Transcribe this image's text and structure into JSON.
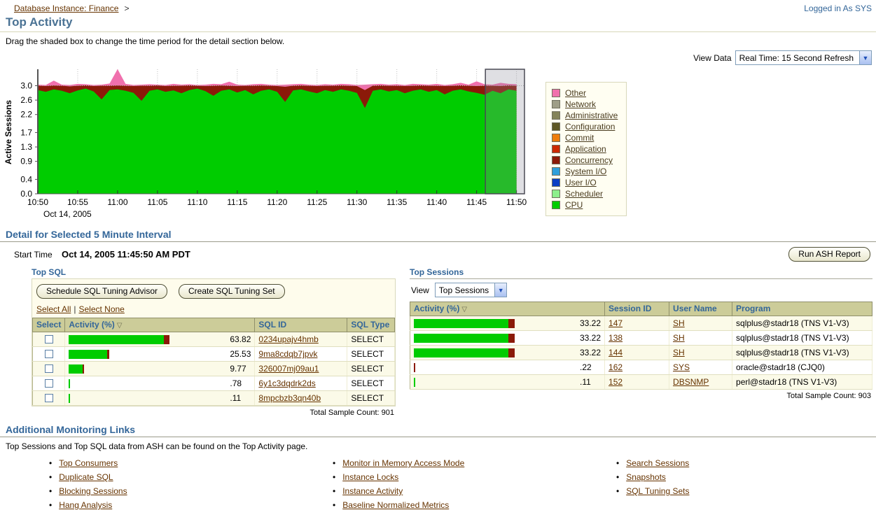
{
  "page": {
    "breadcrumb": "Database Instance: Finance",
    "breadcrumb_separator": ">",
    "logged_in": "Logged in As SYS",
    "title": "Top Activity",
    "instruction": "Drag the shaded box to change the time period for the detail section below.",
    "view_data_label": "View Data",
    "view_data_value": "Real Time: 15 Second Refresh",
    "dropdown_arrow": "▼"
  },
  "chart_data": {
    "type": "area",
    "title": "",
    "xlabel": "",
    "ylabel": "Active Sessions",
    "x_date_label": "Oct 14, 2005",
    "x_ticks": [
      "10:50",
      "10:55",
      "11:00",
      "11:05",
      "11:10",
      "11:15",
      "11:20",
      "11:25",
      "11:30",
      "11:35",
      "11:40",
      "11:45",
      "11:50"
    ],
    "y_ticks": [
      "0.0",
      "0.4",
      "0.9",
      "1.3",
      "1.7",
      "2.2",
      "2.6",
      "3.0"
    ],
    "y_tick_values": [
      0.0,
      0.4,
      0.9,
      1.3,
      1.7,
      2.2,
      2.6,
      3.0
    ],
    "ylim": [
      0,
      3.5
    ],
    "x_minutes_span": 61,
    "grid": "dotted vertical at 5-min marks, dotted horizontal at 3.0",
    "legend_position": "right",
    "selection_box": {
      "start_minute": 56.1,
      "end_minute": 61,
      "note": "shaded drag box over 11:46-11:51"
    },
    "legend": [
      {
        "label": "Other",
        "color": "#F070AD"
      },
      {
        "label": "Network",
        "color": "#9E9E87"
      },
      {
        "label": "Administrative",
        "color": "#84845A"
      },
      {
        "label": "Configuration",
        "color": "#5E5823"
      },
      {
        "label": "Commit",
        "color": "#EE7D0D"
      },
      {
        "label": "Application",
        "color": "#CC2A02"
      },
      {
        "label": "Concurrency",
        "color": "#8B1A09"
      },
      {
        "label": "System I/O",
        "color": "#2F9FDB"
      },
      {
        "label": "User I/O",
        "color": "#0B3EC4"
      },
      {
        "label": "Scheduler",
        "color": "#8CF08C"
      },
      {
        "label": "CPU",
        "color": "#00CC00"
      }
    ],
    "series": [
      {
        "name": "Other stack top",
        "color": "#F070AD",
        "values": [
          3.03,
          3.02,
          3.14,
          3.03,
          3.02,
          3.05,
          3.04,
          3.02,
          3.03,
          3.06,
          3.46,
          3.05,
          3.02,
          3.03,
          3.04,
          3.03,
          3.02,
          3.05,
          3.03,
          3.04,
          3.02,
          3.03,
          3.05,
          3.04,
          3.11,
          3.03,
          3.02,
          3.04,
          3.05,
          3.03,
          3.02,
          3.03,
          3.04,
          3.05,
          3.03,
          3.02,
          3.04,
          3.03,
          3.05,
          3.04,
          3.02,
          3.03,
          3.04,
          3.05,
          3.03,
          3.04,
          3.02,
          3.05,
          3.04,
          3.03,
          3.05,
          3.02,
          3.04,
          3.08,
          3.03,
          3.12,
          3.04,
          3.03,
          3.08,
          3.05,
          3.04
        ]
      },
      {
        "name": "Concurrency stack top",
        "color": "#8B1A09",
        "values": [
          3.0,
          2.99,
          3.01,
          3.0,
          2.98,
          3.0,
          3.01,
          2.99,
          3.0,
          3.0,
          3.01,
          3.0,
          2.99,
          3.0,
          3.0,
          3.01,
          2.99,
          3.0,
          3.0,
          3.01,
          3.0,
          2.99,
          3.0,
          3.01,
          3.0,
          2.99,
          3.0,
          3.0,
          3.01,
          3.0,
          2.99,
          2.97,
          3.0,
          3.01,
          3.0,
          2.99,
          3.0,
          3.0,
          3.01,
          3.0,
          2.99,
          2.88,
          3.0,
          3.01,
          3.0,
          3.0,
          2.99,
          3.0,
          3.01,
          3.0,
          3.0,
          2.99,
          3.0,
          3.01,
          3.0,
          2.99,
          3.0,
          3.0,
          2.99,
          3.01,
          3.0
        ]
      },
      {
        "name": "CPU",
        "color": "#00CC00",
        "values": [
          2.88,
          2.83,
          2.9,
          2.86,
          2.79,
          2.87,
          2.92,
          2.84,
          2.62,
          2.88,
          2.9,
          2.86,
          2.8,
          2.58,
          2.86,
          2.9,
          2.83,
          2.87,
          2.79,
          2.88,
          2.92,
          2.85,
          2.72,
          2.86,
          2.9,
          2.81,
          2.88,
          2.76,
          2.86,
          2.9,
          2.83,
          2.55,
          2.87,
          2.9,
          2.84,
          2.79,
          2.88,
          2.83,
          2.9,
          2.86,
          2.8,
          2.38,
          2.86,
          2.9,
          2.84,
          2.88,
          2.79,
          2.86,
          2.9,
          2.83,
          2.88,
          2.76,
          2.86,
          2.9,
          2.84,
          2.8,
          2.75,
          2.86,
          2.79,
          2.9,
          2.86
        ]
      }
    ]
  },
  "detail": {
    "title": "Detail for Selected 5 Minute Interval",
    "start_time_label": "Start Time",
    "start_time_value": "Oct 14, 2005 11:45:50 AM PDT",
    "run_ash_button": "Run ASH Report"
  },
  "top_sql": {
    "title": "Top SQL",
    "buttons": [
      "Schedule SQL Tuning Advisor",
      "Create SQL Tuning Set"
    ],
    "select_all": "Select All",
    "select_none": "Select None",
    "link_separator": "|",
    "columns": [
      "Select",
      "Activity (%)",
      "SQL ID",
      "SQL Type"
    ],
    "sort_indicator": "▽",
    "rows": [
      {
        "activity": "63.82",
        "bar_green": 60.5,
        "bar_red": 3.3,
        "sql_id": "0234upajv4hmb",
        "sql_type": "SELECT"
      },
      {
        "activity": "25.53",
        "bar_green": 24.2,
        "bar_red": 1.3,
        "sql_id": "9ma8cdqb7jpvk",
        "sql_type": "SELECT"
      },
      {
        "activity": "9.77",
        "bar_green": 8.7,
        "bar_red": 1.1,
        "sql_id": "326007mj09au1",
        "sql_type": "SELECT"
      },
      {
        "activity": ".78",
        "bar_green": 0.8,
        "bar_red": 0,
        "sql_id": "6y1c3dqdrk2ds",
        "sql_type": "SELECT"
      },
      {
        "activity": ".11",
        "bar_green": 0.4,
        "bar_red": 0,
        "sql_id": "8mpcbzb3qn40b",
        "sql_type": "SELECT"
      }
    ],
    "total": "Total Sample Count: 901"
  },
  "top_sessions": {
    "title": "Top Sessions",
    "view_label": "View",
    "view_value": "Top Sessions",
    "columns": [
      "Activity (%)",
      "Session ID",
      "User Name",
      "Program"
    ],
    "sort_indicator": "▽",
    "rows": [
      {
        "activity": "33.22",
        "bar_green": 58,
        "bar_red": 4,
        "session_id": "147",
        "user": "SH",
        "program": "sqlplus@stadr18 (TNS V1-V3)"
      },
      {
        "activity": "33.22",
        "bar_green": 58,
        "bar_red": 4,
        "session_id": "138",
        "user": "SH",
        "program": "sqlplus@stadr18 (TNS V1-V3)"
      },
      {
        "activity": "33.22",
        "bar_green": 58,
        "bar_red": 4,
        "session_id": "144",
        "user": "SH",
        "program": "sqlplus@stadr18 (TNS V1-V3)"
      },
      {
        "activity": ".22",
        "bar_green": 0,
        "bar_red": 0.9,
        "session_id": "162",
        "user": "SYS",
        "program": "oracle@stadr18 (CJQ0)"
      },
      {
        "activity": ".11",
        "bar_green": 0.9,
        "bar_red": 0,
        "session_id": "152",
        "user": "DBSNMP",
        "program": "perl@stadr18 (TNS V1-V3)"
      }
    ],
    "total": "Total Sample Count: 903"
  },
  "monitoring": {
    "title": "Additional Monitoring Links",
    "description": "Top Sessions and Top SQL data from ASH can be found on the Top Activity page.",
    "columns": [
      [
        "Top Consumers",
        "Duplicate SQL",
        "Blocking Sessions",
        "Hang Analysis"
      ],
      [
        "Monitor in Memory Access Mode",
        "Instance Locks",
        "Instance Activity",
        "Baseline Normalized Metrics"
      ],
      [
        "Search Sessions",
        "Snapshots",
        "SQL Tuning Sets"
      ]
    ]
  }
}
